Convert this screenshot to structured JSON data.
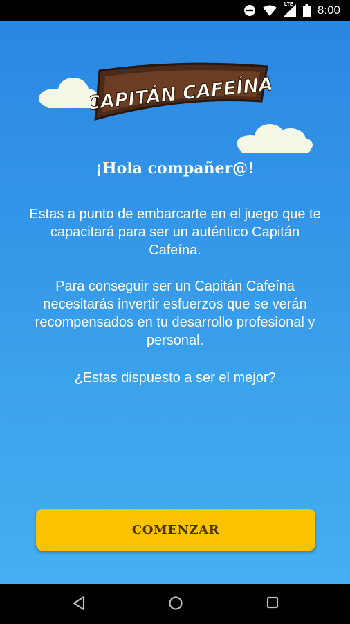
{
  "status_bar": {
    "time": "8:00",
    "network_label": "LTE",
    "icons": [
      "do-not-disturb-icon",
      "wifi-icon",
      "signal-icon",
      "battery-icon"
    ]
  },
  "logo": {
    "text": "CAPITÁN CAFEÍNA"
  },
  "content": {
    "greeting": "¡Hola compañer@!",
    "paragraph_1": "Estas a punto de embarcarte en el juego que te capacitará para ser un auténtico Capitán Cafeína.",
    "paragraph_2": "Para conseguir ser un Capitán Cafeína necesitarás invertir esfuerzos que se verán recompensados en tu desarrollo profesional y personal.",
    "paragraph_3": "¿Estas dispuesto a ser el mejor?"
  },
  "start_button": {
    "label": "COMENZAR",
    "color": "#fbc200"
  },
  "nav_bar": {
    "icons": [
      "back-icon",
      "home-icon",
      "recents-icon"
    ]
  },
  "colors": {
    "background_top": "#2a87e2",
    "background_bottom": "#45b0f1",
    "logo_fill": "#4a2a1a"
  }
}
